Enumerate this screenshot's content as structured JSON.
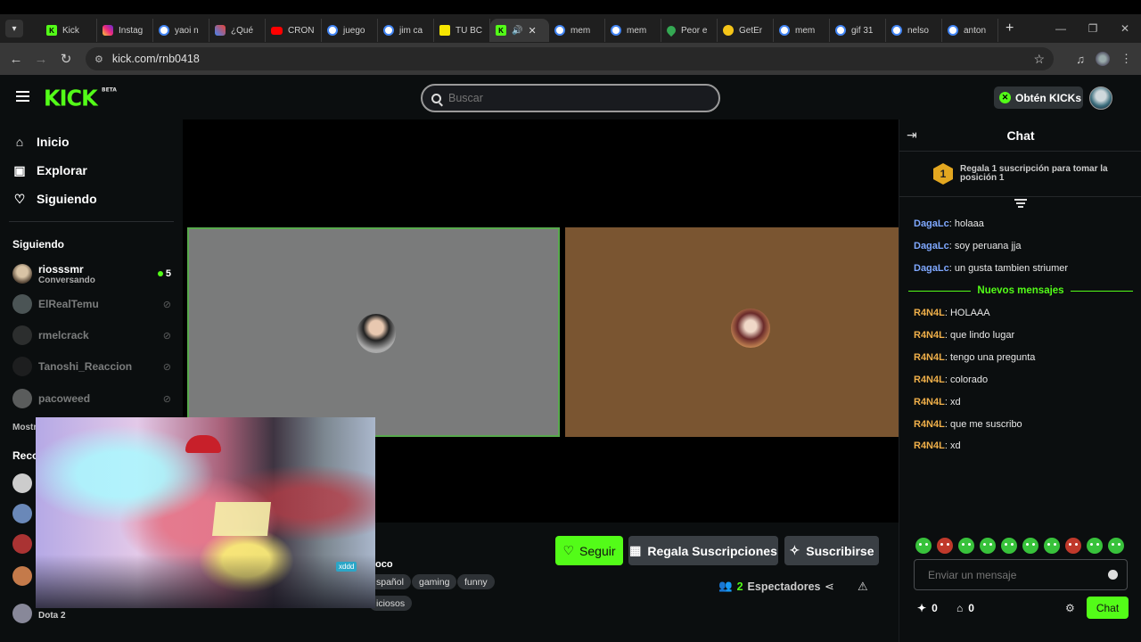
{
  "browser": {
    "tabs": [
      {
        "label": "Kick",
        "icon": "kick-favicon"
      },
      {
        "label": "Instag",
        "icon": "instagram-favicon"
      },
      {
        "label": "yaoi n",
        "icon": "google-favicon"
      },
      {
        "label": "¿Qué",
        "icon": "quiz-favicon"
      },
      {
        "label": "CRON",
        "icon": "youtube-favicon"
      },
      {
        "label": "juego",
        "icon": "google-favicon"
      },
      {
        "label": "jim ca",
        "icon": "google-favicon"
      },
      {
        "label": "TU BC",
        "icon": "tu-favicon"
      },
      {
        "label": "",
        "icon": "kick-favicon",
        "active": true,
        "audio": true
      },
      {
        "label": "mem",
        "icon": "google-favicon"
      },
      {
        "label": "mem",
        "icon": "google-favicon"
      },
      {
        "label": "Peor e",
        "icon": "maps-favicon"
      },
      {
        "label": "GetEr",
        "icon": "emoji-favicon"
      },
      {
        "label": "mem",
        "icon": "google-favicon"
      },
      {
        "label": "gif 31",
        "icon": "google-favicon"
      },
      {
        "label": "nelso",
        "icon": "google-favicon"
      },
      {
        "label": "anton",
        "icon": "google-favicon"
      }
    ],
    "url": "kick.com/rnb0418"
  },
  "header": {
    "logo": "KICK",
    "logo_badge": "BETA",
    "search_placeholder": "Buscar",
    "kicks_button": "Obtén KICKs"
  },
  "sidebar": {
    "nav": [
      {
        "label": "Inicio",
        "icon": "home-icon"
      },
      {
        "label": "Explorar",
        "icon": "compass-icon"
      },
      {
        "label": "Siguiendo",
        "icon": "heart-icon"
      }
    ],
    "following_title": "Siguiendo",
    "following": [
      {
        "name": "riosssmr",
        "sub": "Conversando",
        "live": true,
        "viewers": "5"
      },
      {
        "name": "ElRealTemu",
        "live": false
      },
      {
        "name": "rmelcrack",
        "live": false
      },
      {
        "name": "Tanoshi_Reaccion",
        "live": false
      },
      {
        "name": "pacoweed",
        "live": false
      }
    ],
    "show_more": "Mostr",
    "recommended_title": "Reco",
    "bottom_item": "Dota 2"
  },
  "stream": {
    "follow_button": "Seguir",
    "gift_button": "Regala Suscripciones",
    "subscribe_button": "Suscribirse",
    "title_fragment": "oco",
    "tags": [
      "spañol",
      "gaming",
      "funny",
      "iciosos"
    ],
    "viewers_count": "2",
    "viewers_label": "Espectadores",
    "webcam_sticker": "xddd"
  },
  "chat": {
    "title": "Chat",
    "pinned_rank": "1",
    "pinned_text": "Regala 1 suscripción para tomar la posición 1",
    "messages_before": [
      {
        "user": "DagaLc",
        "text": "holaaa"
      },
      {
        "user": "DagaLc",
        "text": "soy peruana jja"
      },
      {
        "user": "DagaLc",
        "text": "un gusta tambien striumer"
      }
    ],
    "new_messages_label": "Nuevos mensajes",
    "messages_after": [
      {
        "user": "R4N4L",
        "text": "HOLAAA"
      },
      {
        "user": "R4N4L",
        "text": "que lindo lugar"
      },
      {
        "user": "R4N4L",
        "text": "tengo una pregunta"
      },
      {
        "user": "R4N4L",
        "text": "colorado"
      },
      {
        "user": "R4N4L",
        "text": "xd"
      },
      {
        "user": "R4N4L",
        "text": "que me suscribo"
      },
      {
        "user": "R4N4L",
        "text": "xd"
      }
    ],
    "input_placeholder": "Enviar un mensaje",
    "kicks_count": "0",
    "store_count": "0",
    "send_button": "Chat"
  },
  "colors": {
    "accent": "#53fc18",
    "chat_user_blue": "#7fa8ff",
    "chat_user_orange": "#f0b04a"
  }
}
